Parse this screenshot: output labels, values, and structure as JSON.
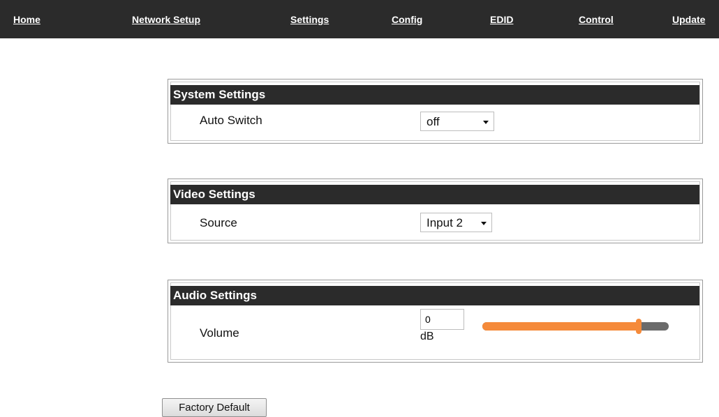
{
  "nav": {
    "items": [
      {
        "label": "Home"
      },
      {
        "label": "Network Setup"
      },
      {
        "label": "Settings"
      },
      {
        "label": "Config"
      },
      {
        "label": "EDID"
      },
      {
        "label": "Control"
      },
      {
        "label": "Update"
      }
    ]
  },
  "system_settings": {
    "title": "System Settings",
    "auto_switch_label": "Auto Switch",
    "auto_switch_value": "off"
  },
  "video_settings": {
    "title": "Video Settings",
    "source_label": "Source",
    "source_value": "Input 2"
  },
  "audio_settings": {
    "title": "Audio Settings",
    "volume_label": "Volume",
    "volume_value": "0",
    "volume_unit": "dB",
    "volume_slider_fraction": 0.84
  },
  "factory_default_label": "Factory Default",
  "colors": {
    "nav_bg": "#2b2b2b",
    "header_bg": "#2b2b2b",
    "slider_fill": "#f58a3a",
    "slider_track": "#6b6b6b"
  }
}
